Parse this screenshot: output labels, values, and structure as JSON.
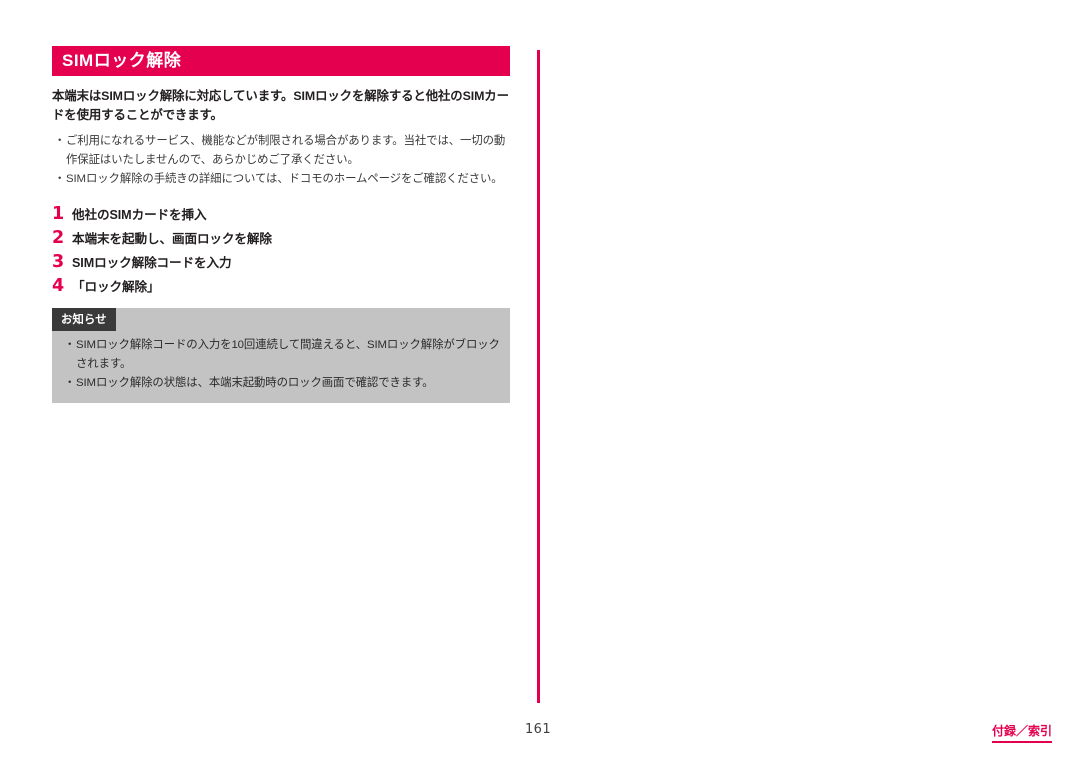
{
  "page": {
    "number": "161",
    "footer_tab": "付録／索引",
    "accent_color": "#e4004f",
    "notice_bg_color": "#c3c3c3",
    "notice_label_bg_color": "#3a3a3a"
  },
  "section": {
    "heading": "SIMロック解除",
    "intro": "本端末はSIMロック解除に対応しています。SIMロックを解除すると他社のSIMカードを使用することができます。",
    "bullets": [
      "ご利用になれるサービス、機能などが制限される場合があります。当社では、一切の動作保証はいたしませんので、あらかじめご了承ください。",
      "SIMロック解除の手続きの詳細については、ドコモのホームページをご確認ください。"
    ],
    "steps": [
      {
        "num": "1",
        "text": "他社のSIMカードを挿入"
      },
      {
        "num": "2",
        "text": "本端末を起動し、画面ロックを解除"
      },
      {
        "num": "3",
        "text": "SIMロック解除コードを入力"
      },
      {
        "num": "4",
        "text": "「ロック解除」"
      }
    ],
    "notice": {
      "label": "お知らせ",
      "items": [
        "SIMロック解除コードの入力を10回連続して間違えると、SIMロック解除がブロックされます。",
        "SIMロック解除の状態は、本端末起動時のロック画面で確認できます。"
      ]
    }
  },
  "bullet_glyph": "・"
}
